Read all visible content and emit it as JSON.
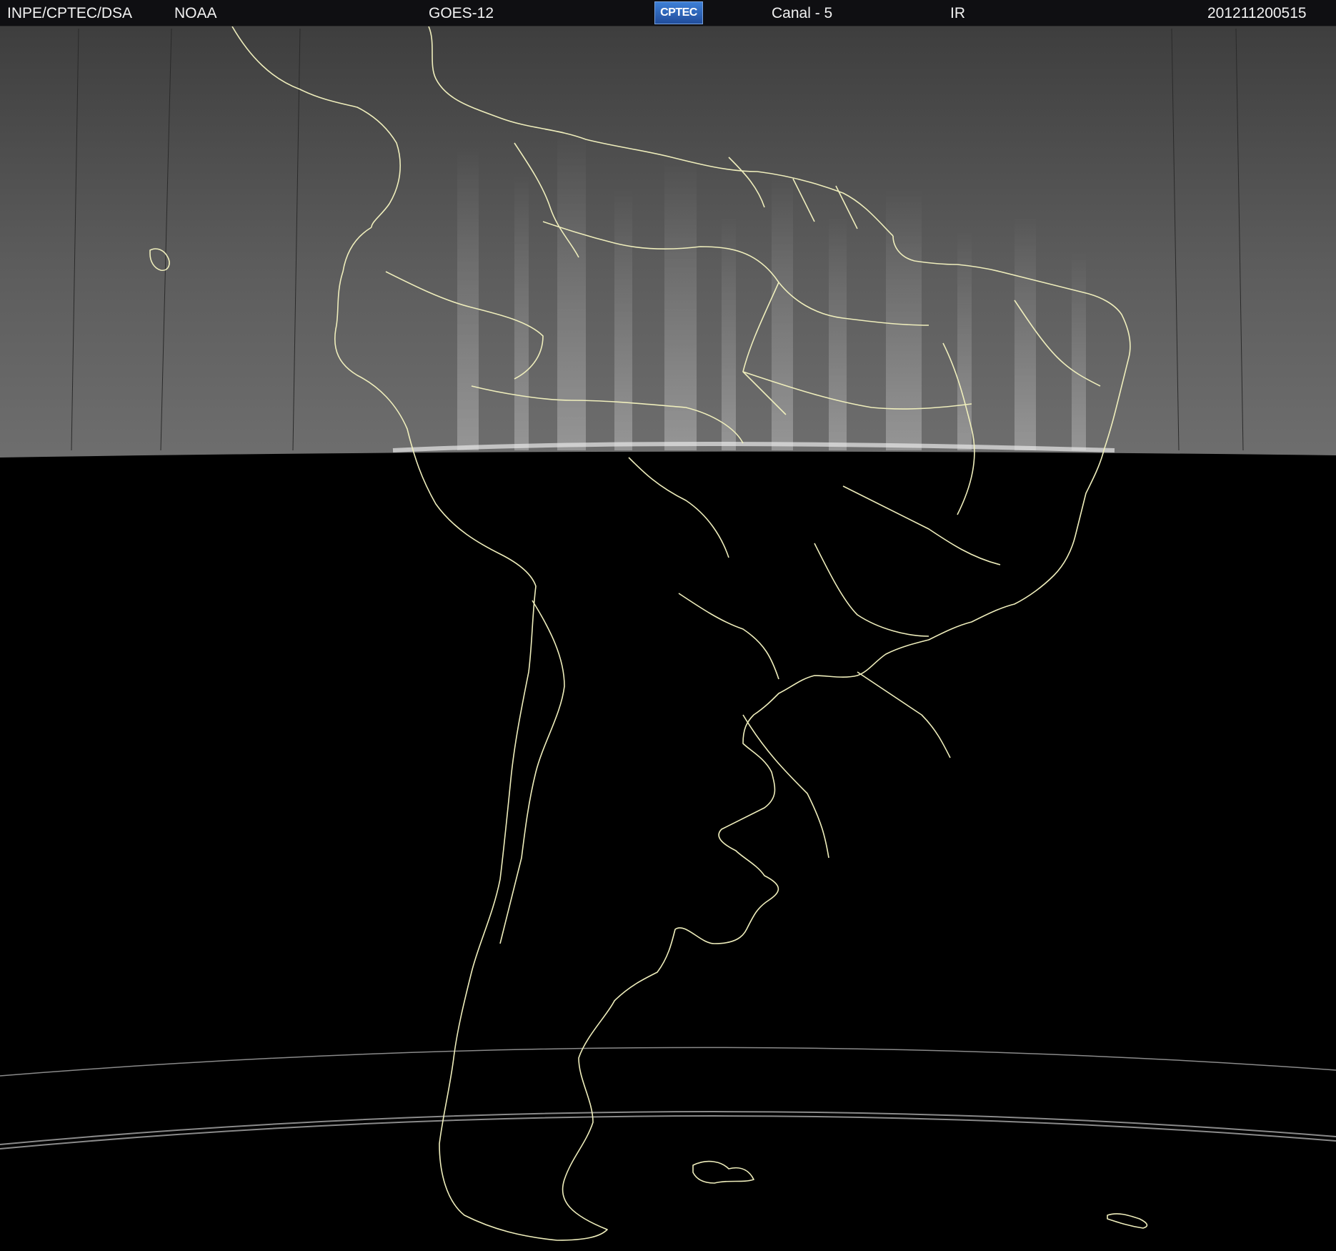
{
  "header": {
    "org": "INPE/CPTEC/DSA",
    "agency": "NOAA",
    "satellite": "GOES-12",
    "logo_text": "CPTEC",
    "channel": "Canal - 5",
    "band": "IR",
    "timestamp": "201211200515"
  },
  "map": {
    "region": "South America",
    "boundary_color": "#efeebc",
    "cloud_region_color": "#5a5a5a",
    "night_region_color": "#000000",
    "scan_line_color": "#8a8a8a",
    "icons": [
      "cptec-logo"
    ]
  }
}
